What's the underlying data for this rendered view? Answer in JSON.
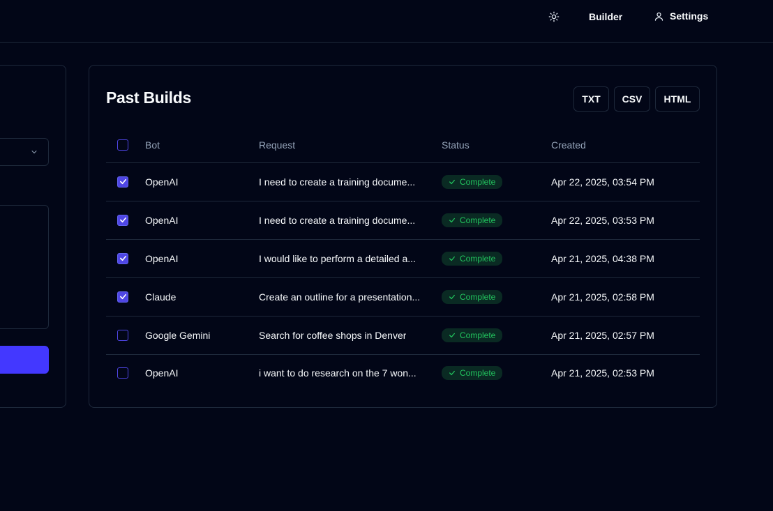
{
  "nav": {
    "theme_icon": "sun-icon",
    "builder_label": "Builder",
    "settings_icon": "user-icon",
    "settings_label": "Settings"
  },
  "left_panel": {
    "select_icon": "chevron-down-icon"
  },
  "past_builds": {
    "title": "Past Builds",
    "export_buttons": [
      "TXT",
      "CSV",
      "HTML"
    ],
    "columns": [
      "Bot",
      "Request",
      "Status",
      "Created"
    ],
    "rows": [
      {
        "checked": true,
        "bot": "OpenAI",
        "request": "I need to create a training docume...",
        "status": "Complete",
        "created": "Apr 22, 2025, 03:54 PM"
      },
      {
        "checked": true,
        "bot": "OpenAI",
        "request": "I need to create a training docume...",
        "status": "Complete",
        "created": "Apr 22, 2025, 03:53 PM"
      },
      {
        "checked": true,
        "bot": "OpenAI",
        "request": "I would like to perform a detailed a...",
        "status": "Complete",
        "created": "Apr 21, 2025, 04:38 PM"
      },
      {
        "checked": true,
        "bot": "Claude",
        "request": "Create an outline for a presentation...",
        "status": "Complete",
        "created": "Apr 21, 2025, 02:58 PM"
      },
      {
        "checked": false,
        "bot": "Google Gemini",
        "request": "Search for coffee shops in Denver",
        "status": "Complete",
        "created": "Apr 21, 2025, 02:57 PM"
      },
      {
        "checked": false,
        "bot": "OpenAI",
        "request": "i want to do research on the 7 won...",
        "status": "Complete",
        "created": "Apr 21, 2025, 02:53 PM"
      }
    ]
  },
  "colors": {
    "background": "#020617",
    "accent": "#4f46e5",
    "status_complete": "#22c55e",
    "border": "#1e293b"
  }
}
